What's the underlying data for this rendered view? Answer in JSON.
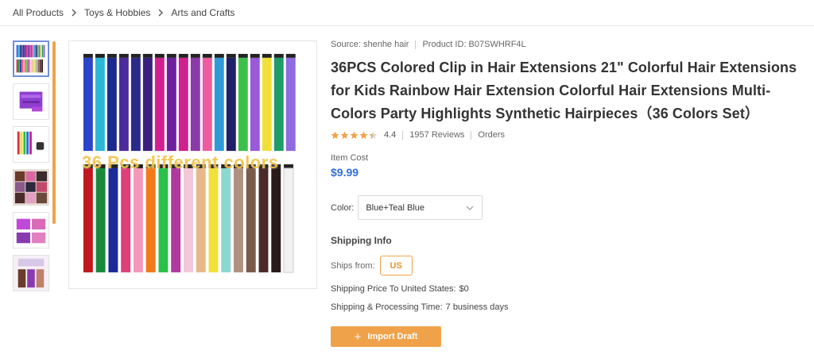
{
  "breadcrumb": {
    "items": [
      "All Products",
      "Toys & Hobbies",
      "Arts and Crafts"
    ]
  },
  "product": {
    "source_label": "Source: shenhe hair",
    "product_id_label": "Product ID: B07SWHRF4L",
    "title": "36PCS Colored Clip in Hair Extensions 21\" Colorful Hair Extensions for Kids Rainbow Hair Extension Colorful Hair Extensions Multi-Colors Party Highlights Synthetic Hairpieces（36 Colors Set）",
    "rating": "4.4",
    "rating_value": 4.4,
    "reviews": "1957 Reviews",
    "orders": "Orders",
    "cost_label": "Item Cost",
    "price": "$9.99",
    "color_label": "Color:",
    "color_value": "Blue+Teal Blue",
    "image_overlay_text": "36 Pcs different colors"
  },
  "shipping": {
    "title": "Shipping Info",
    "ships_from_label": "Ships from:",
    "ships_from_value": "US",
    "price_label": "Shipping Price To United States:",
    "price_value": "$0",
    "time_label": "Shipping & Processing Time:",
    "time_value": "7 business days"
  },
  "actions": {
    "import_label": "Import Draft"
  },
  "colors": {
    "accent": "#f0a24a",
    "price": "#2f6fd6",
    "star": "#f0a24a"
  },
  "hair_colors_top": [
    "#2a44c9",
    "#2cb6d8",
    "#1b2a8c",
    "#4b2a9c",
    "#2a2a8a",
    "#3a1f7d",
    "#d21f8f",
    "#6d1f9e",
    "#d02090",
    "#8a3aa8",
    "#ef5aa0",
    "#2e9bd8",
    "#1f1f6a",
    "#3cc04a",
    "#9a5ad8",
    "#f2e03a",
    "#1f9c6a",
    "#8f6ae0"
  ],
  "hair_colors_bottom": [
    "#c0181e",
    "#1a8a3a",
    "#1a2a9a",
    "#e0407a",
    "#f29ab8",
    "#f27a18",
    "#2cc04a",
    "#b03aa0",
    "#f2c8d8",
    "#e8b88a",
    "#f2e03a",
    "#8ad8d0",
    "#b09080",
    "#7a5a4a",
    "#4a2a2a",
    "#2a1a1a",
    "#f2f2f2"
  ]
}
